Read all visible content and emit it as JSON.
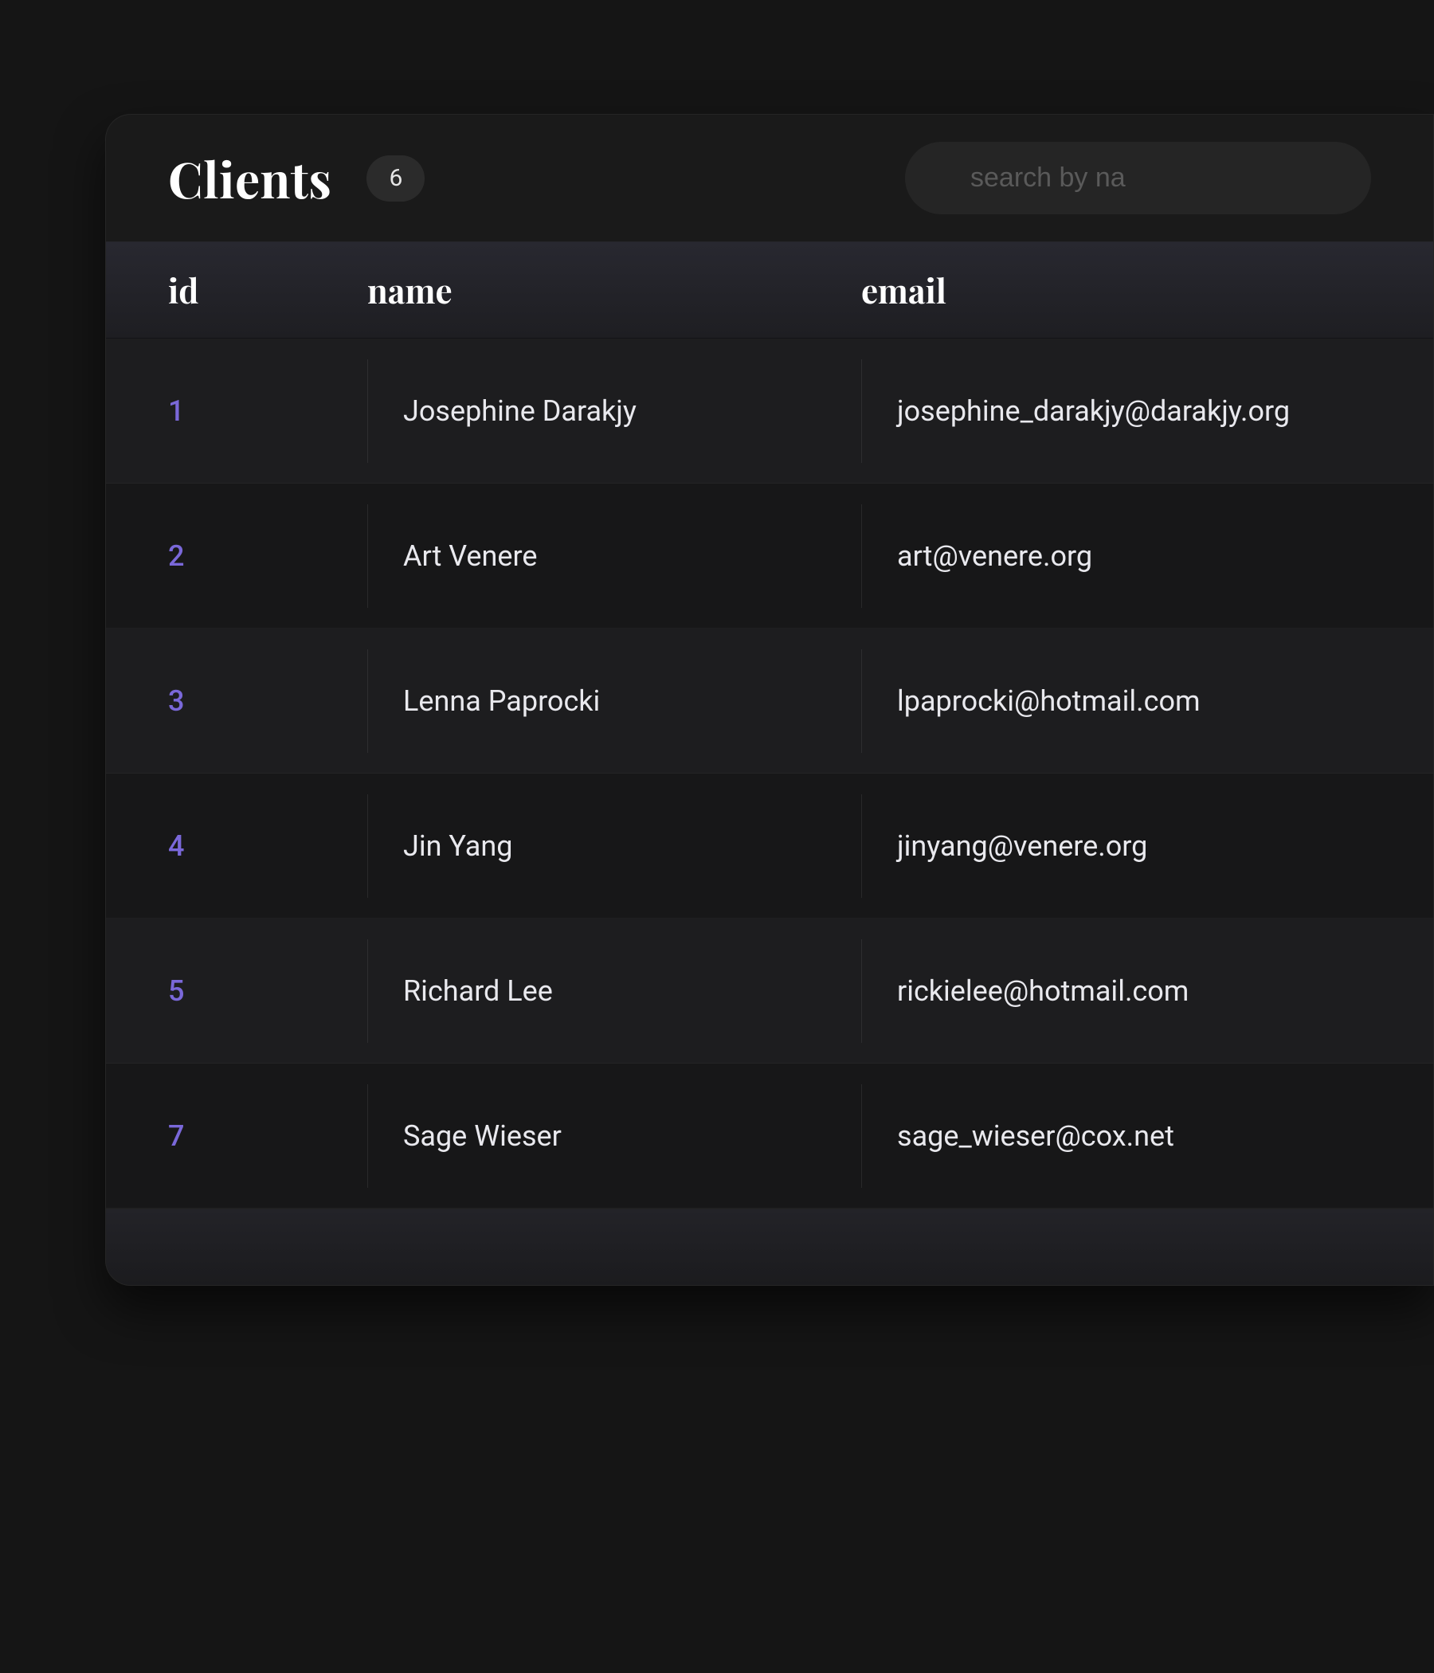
{
  "header": {
    "title": "Clients",
    "count": "6",
    "search_placeholder": "search by na"
  },
  "columns": {
    "id": "id",
    "name": "name",
    "email": "email"
  },
  "rows": [
    {
      "id": "1",
      "name": "Josephine Darakjy",
      "email": "josephine_darakjy@darakjy.org"
    },
    {
      "id": "2",
      "name": "Art Venere",
      "email": "art@venere.org"
    },
    {
      "id": "3",
      "name": "Lenna Paprocki",
      "email": "lpaprocki@hotmail.com"
    },
    {
      "id": "4",
      "name": "Jin Yang",
      "email": "jinyang@venere.org"
    },
    {
      "id": "5",
      "name": "Richard Lee",
      "email": "rickielee@hotmail.com"
    },
    {
      "id": "7",
      "name": "Sage Wieser",
      "email": "sage_wieser@cox.net"
    }
  ]
}
